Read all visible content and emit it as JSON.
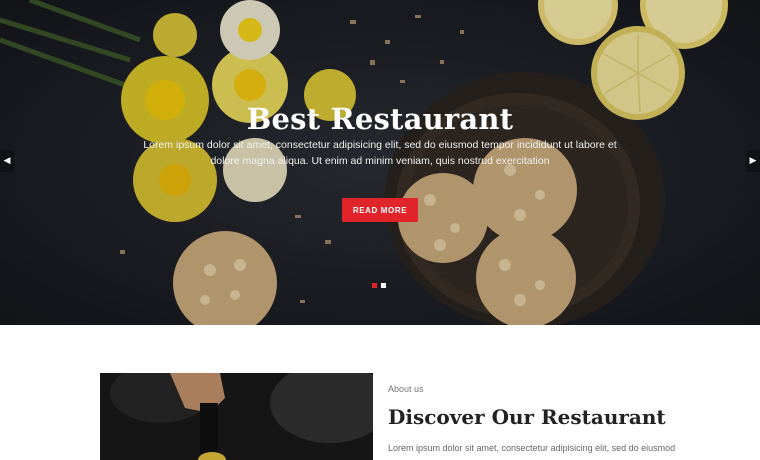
{
  "hero": {
    "title": "Best Restaurant",
    "text": "Lorem ipsum dolor sit amet, consectetur adipisicing elit, sed do eiusmod tempor incididunt ut labore et dolore magna aliqua. Ut enim ad minim veniam, quis nostrud exercitation",
    "button_label": "READ MORE",
    "prev_icon": "chevron-left-icon",
    "next_icon": "chevron-right-icon",
    "slides_total": 2,
    "active_slide": 1
  },
  "about": {
    "label": "About us",
    "title": "Discover Our Restaurant",
    "text": "Lorem ipsum dolor sit amet, consectetur adipisicing elit, sed do eiusmod"
  },
  "colors": {
    "accent": "#e0242a",
    "hero_dark": "#1d2026",
    "heading": "#222222"
  }
}
